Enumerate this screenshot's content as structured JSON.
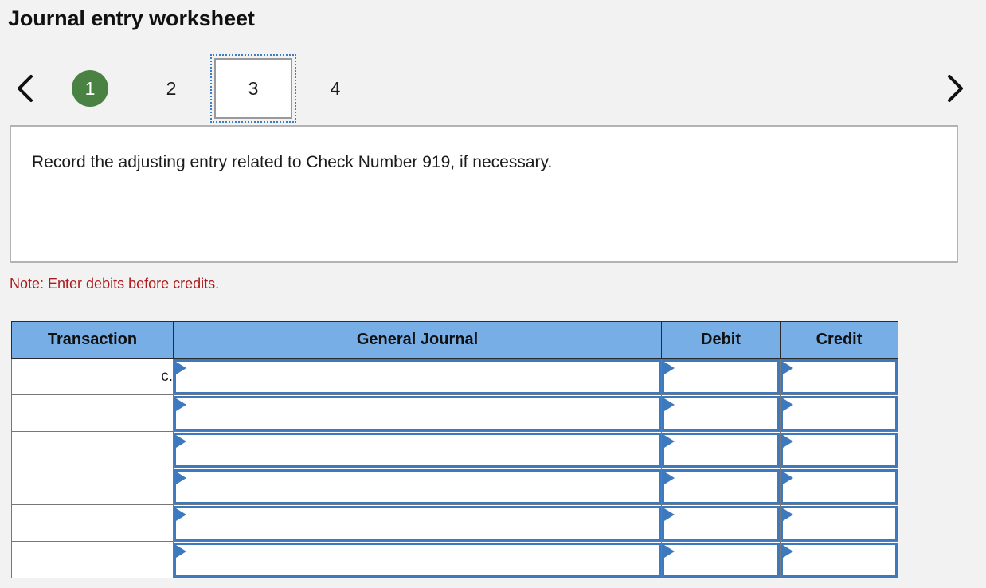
{
  "page_title": "Journal entry worksheet",
  "pager": {
    "prev_icon": "chevron-left-icon",
    "next_icon": "chevron-right-icon",
    "steps": [
      {
        "label": "1",
        "state": "done"
      },
      {
        "label": "2",
        "state": "default"
      },
      {
        "label": "3",
        "state": "current"
      },
      {
        "label": "4",
        "state": "default"
      }
    ]
  },
  "instruction": {
    "text": "Record the adjusting entry related to Check Number 919, if necessary."
  },
  "note": "Note: Enter debits before credits.",
  "table": {
    "headers": [
      "Transaction",
      "General Journal",
      "Debit",
      "Credit"
    ],
    "rows": [
      {
        "transaction": "c.",
        "general_journal": "",
        "debit": "",
        "credit": ""
      },
      {
        "transaction": "",
        "general_journal": "",
        "debit": "",
        "credit": ""
      },
      {
        "transaction": "",
        "general_journal": "",
        "debit": "",
        "credit": ""
      },
      {
        "transaction": "",
        "general_journal": "",
        "debit": "",
        "credit": ""
      },
      {
        "transaction": "",
        "general_journal": "",
        "debit": "",
        "credit": ""
      },
      {
        "transaction": "",
        "general_journal": "",
        "debit": "",
        "credit": ""
      }
    ]
  },
  "colors": {
    "background": "#f2f2f2",
    "header_blue": "#78aee6",
    "step_green": "#4a8244",
    "note_red": "#ad1c1c",
    "input_blue": "#3d79bf",
    "focus_blue": "#3d7dc4"
  }
}
